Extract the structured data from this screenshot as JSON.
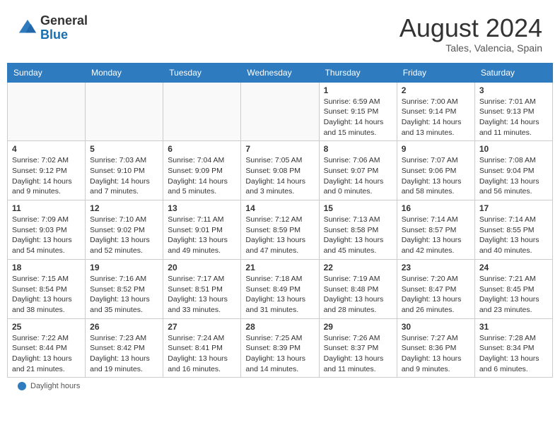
{
  "header": {
    "logo_general": "General",
    "logo_blue": "Blue",
    "month_year": "August 2024",
    "location": "Tales, Valencia, Spain"
  },
  "footer": {
    "label": "Daylight hours"
  },
  "calendar": {
    "days_of_week": [
      "Sunday",
      "Monday",
      "Tuesday",
      "Wednesday",
      "Thursday",
      "Friday",
      "Saturday"
    ],
    "weeks": [
      [
        {
          "day": "",
          "info": ""
        },
        {
          "day": "",
          "info": ""
        },
        {
          "day": "",
          "info": ""
        },
        {
          "day": "",
          "info": ""
        },
        {
          "day": "1",
          "info": "Sunrise: 6:59 AM\nSunset: 9:15 PM\nDaylight: 14 hours and 15 minutes."
        },
        {
          "day": "2",
          "info": "Sunrise: 7:00 AM\nSunset: 9:14 PM\nDaylight: 14 hours and 13 minutes."
        },
        {
          "day": "3",
          "info": "Sunrise: 7:01 AM\nSunset: 9:13 PM\nDaylight: 14 hours and 11 minutes."
        }
      ],
      [
        {
          "day": "4",
          "info": "Sunrise: 7:02 AM\nSunset: 9:12 PM\nDaylight: 14 hours and 9 minutes."
        },
        {
          "day": "5",
          "info": "Sunrise: 7:03 AM\nSunset: 9:10 PM\nDaylight: 14 hours and 7 minutes."
        },
        {
          "day": "6",
          "info": "Sunrise: 7:04 AM\nSunset: 9:09 PM\nDaylight: 14 hours and 5 minutes."
        },
        {
          "day": "7",
          "info": "Sunrise: 7:05 AM\nSunset: 9:08 PM\nDaylight: 14 hours and 3 minutes."
        },
        {
          "day": "8",
          "info": "Sunrise: 7:06 AM\nSunset: 9:07 PM\nDaylight: 14 hours and 0 minutes."
        },
        {
          "day": "9",
          "info": "Sunrise: 7:07 AM\nSunset: 9:06 PM\nDaylight: 13 hours and 58 minutes."
        },
        {
          "day": "10",
          "info": "Sunrise: 7:08 AM\nSunset: 9:04 PM\nDaylight: 13 hours and 56 minutes."
        }
      ],
      [
        {
          "day": "11",
          "info": "Sunrise: 7:09 AM\nSunset: 9:03 PM\nDaylight: 13 hours and 54 minutes."
        },
        {
          "day": "12",
          "info": "Sunrise: 7:10 AM\nSunset: 9:02 PM\nDaylight: 13 hours and 52 minutes."
        },
        {
          "day": "13",
          "info": "Sunrise: 7:11 AM\nSunset: 9:01 PM\nDaylight: 13 hours and 49 minutes."
        },
        {
          "day": "14",
          "info": "Sunrise: 7:12 AM\nSunset: 8:59 PM\nDaylight: 13 hours and 47 minutes."
        },
        {
          "day": "15",
          "info": "Sunrise: 7:13 AM\nSunset: 8:58 PM\nDaylight: 13 hours and 45 minutes."
        },
        {
          "day": "16",
          "info": "Sunrise: 7:14 AM\nSunset: 8:57 PM\nDaylight: 13 hours and 42 minutes."
        },
        {
          "day": "17",
          "info": "Sunrise: 7:14 AM\nSunset: 8:55 PM\nDaylight: 13 hours and 40 minutes."
        }
      ],
      [
        {
          "day": "18",
          "info": "Sunrise: 7:15 AM\nSunset: 8:54 PM\nDaylight: 13 hours and 38 minutes."
        },
        {
          "day": "19",
          "info": "Sunrise: 7:16 AM\nSunset: 8:52 PM\nDaylight: 13 hours and 35 minutes."
        },
        {
          "day": "20",
          "info": "Sunrise: 7:17 AM\nSunset: 8:51 PM\nDaylight: 13 hours and 33 minutes."
        },
        {
          "day": "21",
          "info": "Sunrise: 7:18 AM\nSunset: 8:49 PM\nDaylight: 13 hours and 31 minutes."
        },
        {
          "day": "22",
          "info": "Sunrise: 7:19 AM\nSunset: 8:48 PM\nDaylight: 13 hours and 28 minutes."
        },
        {
          "day": "23",
          "info": "Sunrise: 7:20 AM\nSunset: 8:47 PM\nDaylight: 13 hours and 26 minutes."
        },
        {
          "day": "24",
          "info": "Sunrise: 7:21 AM\nSunset: 8:45 PM\nDaylight: 13 hours and 23 minutes."
        }
      ],
      [
        {
          "day": "25",
          "info": "Sunrise: 7:22 AM\nSunset: 8:44 PM\nDaylight: 13 hours and 21 minutes."
        },
        {
          "day": "26",
          "info": "Sunrise: 7:23 AM\nSunset: 8:42 PM\nDaylight: 13 hours and 19 minutes."
        },
        {
          "day": "27",
          "info": "Sunrise: 7:24 AM\nSunset: 8:41 PM\nDaylight: 13 hours and 16 minutes."
        },
        {
          "day": "28",
          "info": "Sunrise: 7:25 AM\nSunset: 8:39 PM\nDaylight: 13 hours and 14 minutes."
        },
        {
          "day": "29",
          "info": "Sunrise: 7:26 AM\nSunset: 8:37 PM\nDaylight: 13 hours and 11 minutes."
        },
        {
          "day": "30",
          "info": "Sunrise: 7:27 AM\nSunset: 8:36 PM\nDaylight: 13 hours and 9 minutes."
        },
        {
          "day": "31",
          "info": "Sunrise: 7:28 AM\nSunset: 8:34 PM\nDaylight: 13 hours and 6 minutes."
        }
      ]
    ]
  }
}
